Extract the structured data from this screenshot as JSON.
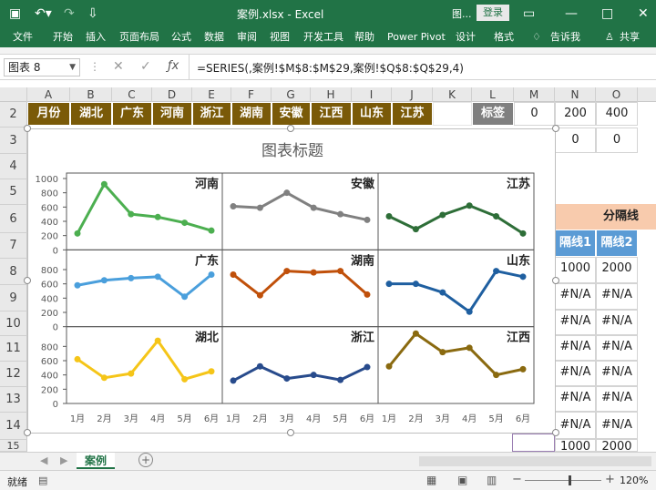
{
  "window": {
    "filename": "案例.xlsx",
    "sep": " - ",
    "app": "Excel",
    "context_tab": "图...",
    "login": "登录"
  },
  "ribbon": {
    "tabs": [
      "文件",
      "开始",
      "插入",
      "页面布局",
      "公式",
      "数据",
      "审阅",
      "视图",
      "开发工具",
      "帮助",
      "Power Pivot",
      "设计",
      "格式"
    ],
    "tell_me": "告诉我",
    "share": "共享"
  },
  "formula": {
    "name_box": "图表 8",
    "content": "=SERIES(,案例!$M$8:$M$29,案例!$Q$8:$Q$29,4)"
  },
  "columns": [
    "A",
    "B",
    "C",
    "D",
    "E",
    "F",
    "G",
    "H",
    "I",
    "J",
    "K",
    "L",
    "M",
    "N",
    "O"
  ],
  "rows": [
    "2",
    "3",
    "4",
    "5",
    "6",
    "7",
    "8",
    "9",
    "10",
    "11",
    "12",
    "13",
    "14",
    "15"
  ],
  "row2": {
    "headers": [
      "月份",
      "湖北",
      "广东",
      "河南",
      "浙江",
      "湖南",
      "安徽",
      "江西",
      "山东",
      "江苏"
    ],
    "label": "标签",
    "m": "0",
    "n": "200",
    "o": "400"
  },
  "row3": {
    "n": "0",
    "o": "0"
  },
  "right_table": {
    "title": "分隔线",
    "col1": "隔线1",
    "col2": "隔线2",
    "r8": [
      "1000",
      "2000"
    ],
    "na": "#N/A",
    "r15": [
      "1000",
      "2000"
    ]
  },
  "chart_data": {
    "type": "line",
    "title": "图表标题",
    "categories": [
      "1月",
      "2月",
      "3月",
      "4月",
      "5月",
      "6月"
    ],
    "yticks": [
      "1000",
      "800",
      "600",
      "400",
      "200",
      "0"
    ],
    "ylim": [
      0,
      1000
    ],
    "grid": false,
    "panels": [
      {
        "name": "河南",
        "color": "#4caf50",
        "values": [
          230,
          920,
          500,
          460,
          380,
          270
        ]
      },
      {
        "name": "安徽",
        "color": "#808080",
        "values": [
          610,
          590,
          800,
          590,
          500,
          420
        ]
      },
      {
        "name": "江苏",
        "color": "#2e6e38",
        "values": [
          470,
          290,
          490,
          620,
          470,
          230
        ]
      },
      {
        "name": "广东",
        "color": "#4a9fdc",
        "values": [
          580,
          650,
          680,
          700,
          420,
          730
        ]
      },
      {
        "name": "湖南",
        "color": "#c0500a",
        "values": [
          730,
          440,
          780,
          760,
          780,
          450
        ]
      },
      {
        "name": "山东",
        "color": "#1f5fa0",
        "values": [
          600,
          600,
          480,
          210,
          780,
          700
        ]
      },
      {
        "name": "湖北",
        "color": "#f5c518",
        "values": [
          620,
          360,
          420,
          880,
          340,
          450
        ]
      },
      {
        "name": "浙江",
        "color": "#284b8c",
        "values": [
          320,
          520,
          350,
          400,
          330,
          510
        ]
      },
      {
        "name": "江西",
        "color": "#8a6a10",
        "values": [
          520,
          980,
          720,
          780,
          400,
          480
        ]
      }
    ]
  },
  "sheet": {
    "tab": "案例"
  },
  "status": {
    "ready": "就绪",
    "zoom": "120%"
  }
}
